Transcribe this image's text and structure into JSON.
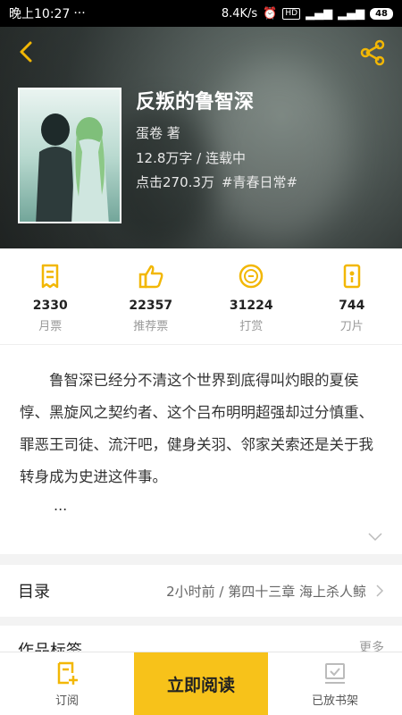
{
  "status_bar": {
    "time": "晚上10:27",
    "network_speed": "8.4K/s",
    "hd_badge": "HD",
    "battery": "48"
  },
  "book": {
    "title": "反叛的鲁智深",
    "author": "蛋卷 著",
    "word_count_status": "12.8万字 / 连载中",
    "clicks": "点击270.3万",
    "tag": "#青春日常#"
  },
  "stats": [
    {
      "icon": "monthly-ticket-icon",
      "value": "2330",
      "label": "月票"
    },
    {
      "icon": "thumbs-up-icon",
      "value": "22357",
      "label": "推荐票"
    },
    {
      "icon": "reward-coin-icon",
      "value": "31224",
      "label": "打赏"
    },
    {
      "icon": "blade-icon",
      "value": "744",
      "label": "刀片"
    }
  ],
  "description": {
    "text": "鲁智深已经分不清这个世界到底得叫灼眼的夏侯惇、黑旋风之契约者、这个吕布明明超强却过分慎重、罪恶王司徒、流汗吧，健身关羽、邻家关索还是关于我转身成为史进这件事。",
    "ellipsis": "..."
  },
  "catalog": {
    "label": "目录",
    "latest": "2小时前 / 第四十三章 海上杀人鲸"
  },
  "tags_row": {
    "label": "作品标签",
    "more": "更多"
  },
  "bottom_bar": {
    "subscribe": "订阅",
    "read_now": "立即阅读",
    "on_shelf": "已放书架"
  },
  "colors": {
    "accent": "#f7c21a",
    "icon_yellow": "#f2b705"
  }
}
